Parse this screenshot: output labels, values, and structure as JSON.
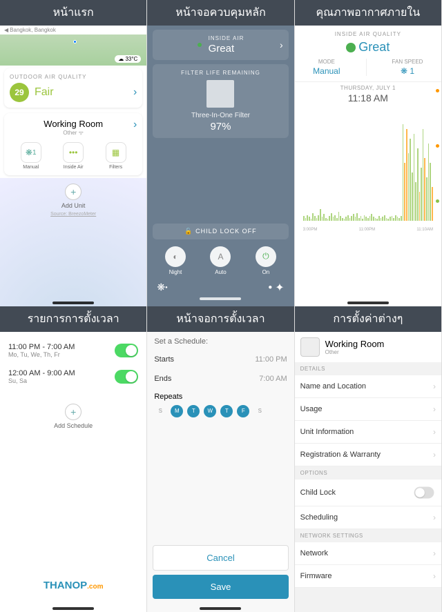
{
  "headers": [
    "หน้าแรก",
    "หน้าจอควบคุมหลัก",
    "คุณภาพอากาศภายใน",
    "รายการการตั้งเวลา",
    "หน้าจอการตั้งเวลา",
    "การตั้งค่าต่างๆ"
  ],
  "home": {
    "location": "Bangkok, Bangkok",
    "temp": "33°C",
    "oaq_label": "OUTDOOR AIR QUALITY",
    "oaq_value": "29",
    "oaq_status": "Fair",
    "room_name": "Working Room",
    "room_sub": "Other",
    "tiles": [
      {
        "icon": "⚙",
        "value": "1",
        "label": "Manual"
      },
      {
        "icon": "•••",
        "value": "",
        "label": "Inside Air"
      },
      {
        "icon": "▦",
        "value": "",
        "label": "Filters"
      }
    ],
    "add_unit": "Add Unit",
    "source": "Source: BreezoMeter"
  },
  "main": {
    "inside_label": "INSIDE AIR",
    "inside_value": "Great",
    "filter_label": "FILTER LIFE REMAINING",
    "filter_name": "Three-In-One Filter",
    "filter_pct": "97%",
    "child_lock": "CHILD LOCK OFF",
    "controls": [
      {
        "icon": "◐",
        "label": "Night"
      },
      {
        "icon": "A",
        "label": "Auto"
      },
      {
        "icon": "⏻",
        "label": "On"
      }
    ]
  },
  "iaq": {
    "label": "INSIDE AIR QUALITY",
    "value": "Great",
    "mode_label": "MODE",
    "mode_value": "Manual",
    "fan_label": "FAN SPEED",
    "fan_value": "1",
    "day": "THURSDAY, JULY 1",
    "time": "11:18 AM",
    "xlabels": [
      "3:00PM",
      "11:00PM",
      "11:10AM"
    ]
  },
  "schedlist": {
    "items": [
      {
        "time": "11:00 PM  -  7:00 AM",
        "days": "Mo, Tu, We, Th, Fr",
        "on": true
      },
      {
        "time": "12:00 AM  -  9:00 AM",
        "days": "Su, Sa",
        "on": true
      }
    ],
    "add": "Add Schedule"
  },
  "schededit": {
    "title": "Set a Schedule:",
    "starts_label": "Starts",
    "starts_value": "11:00 PM",
    "ends_label": "Ends",
    "ends_value": "7:00 AM",
    "repeats": "Repeats",
    "days": [
      "S",
      "M",
      "T",
      "W",
      "T",
      "F",
      "S"
    ],
    "days_on": [
      false,
      true,
      true,
      true,
      true,
      true,
      false
    ],
    "cancel": "Cancel",
    "save": "Save"
  },
  "settings": {
    "room": "Working Room",
    "room_sub": "Other",
    "details_label": "DETAILS",
    "details": [
      "Name and Location",
      "Usage",
      "Unit Information",
      "Registration & Warranty"
    ],
    "options_label": "OPTIONS",
    "opt_childlock": "Child Lock",
    "opt_scheduling": "Scheduling",
    "net_label": "NETWORK SETTINGS",
    "net": [
      "Network",
      "Firmware"
    ]
  },
  "watermark": {
    "a": "THANOP",
    "b": ".com"
  }
}
